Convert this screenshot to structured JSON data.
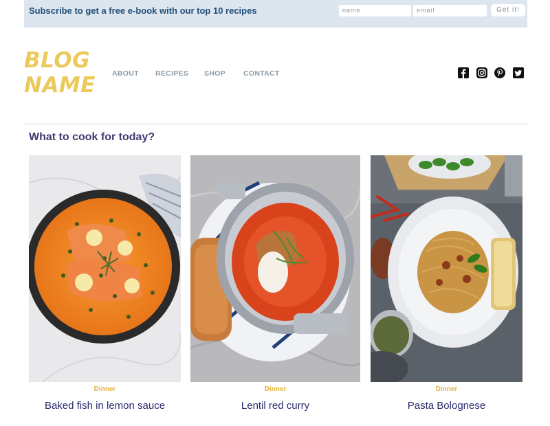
{
  "subscribe": {
    "text": "Subscribe to get a free e-book with our top 10 recipes",
    "name_placeholder": "name",
    "email_placeholder": "email",
    "button_label": "Get it!"
  },
  "header": {
    "logo": "BLOG NAME",
    "nav": [
      "ABOUT",
      "RECIPES",
      "SHOP",
      "CONTACT"
    ],
    "social_icons": [
      "facebook-icon",
      "instagram-icon",
      "pinterest-icon",
      "twitter-icon"
    ]
  },
  "main": {
    "section_title": "What to cook for today?",
    "cards": [
      {
        "category": "Dinner",
        "title": "Baked fish in lemon sauce",
        "image": "baked-fish-photo"
      },
      {
        "category": "Dinner",
        "title": "Lentil red curry",
        "image": "lentil-curry-photo"
      },
      {
        "category": "Dinner",
        "title": "Pasta Bolognese",
        "image": "pasta-bolognese-photo"
      }
    ]
  },
  "colors": {
    "subscribe_bg": "#dde5ee",
    "subscribe_text": "#1f4e79",
    "logo": "#ebc95c",
    "nav": "#8a9aa6",
    "section_title": "#3d3b6e",
    "category": "#e2b43f",
    "card_title": "#2a2a6e"
  }
}
